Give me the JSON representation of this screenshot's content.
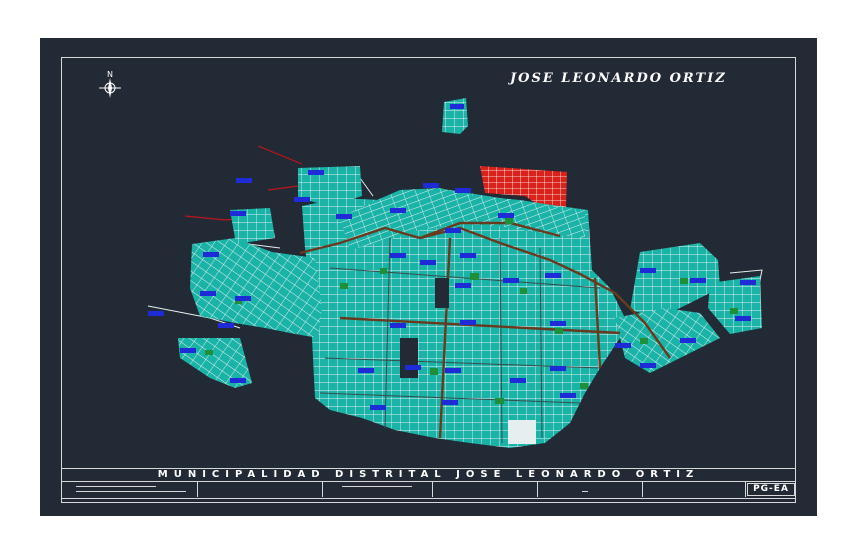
{
  "map": {
    "title": "JOSE LEONARDO ORTIZ",
    "north_arrow_icon": "north-arrow-icon",
    "colors": {
      "background": "#222a35",
      "blocks": "#1ab3a8",
      "streets": "#e6efef",
      "labels": "#1f2bd6",
      "main_roads": "#6a3a1f",
      "highlight_area": "#d9221c",
      "boundary_lines": "#c0141a",
      "frame": "#d8d8d8"
    }
  },
  "title_block": {
    "municipality": "MUNICIPALIDAD DISTRITAL JOSE LEONARDO ORTIZ",
    "sheet_code": "PG-EA"
  }
}
